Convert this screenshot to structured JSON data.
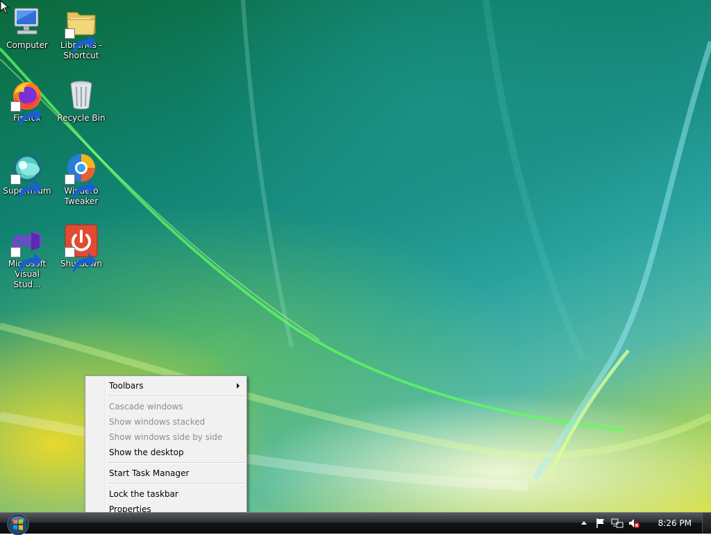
{
  "desktop": {
    "icons": [
      {
        "label": "Computer",
        "icon": "computer-icon"
      },
      {
        "label": "Libraries - Shortcut",
        "icon": "folder-icon"
      },
      {
        "label": "Firefox",
        "icon": "firefox-icon"
      },
      {
        "label": "Recycle Bin",
        "icon": "recycle-bin-icon"
      },
      {
        "label": "Supermium",
        "icon": "supermium-icon"
      },
      {
        "label": "Winaero Tweaker",
        "icon": "winaero-icon"
      },
      {
        "label": "Microsoft Visual Stud...",
        "icon": "visual-studio-icon"
      },
      {
        "label": "Shutdown",
        "icon": "shutdown-icon"
      }
    ]
  },
  "context_menu": {
    "toolbars": "Toolbars",
    "cascade": "Cascade windows",
    "stacked": "Show windows stacked",
    "side_by_side": "Show windows side by side",
    "show_desktop": "Show the desktop",
    "task_manager": "Start Task Manager",
    "lock": "Lock the taskbar",
    "properties": "Properties"
  },
  "taskbar": {
    "clock": "8:26 PM",
    "tray_icons": [
      "show-hidden-icons",
      "action-center-flag-icon",
      "network-icon",
      "volume-muted-icon"
    ]
  },
  "colors": {
    "accent": "#1a8f86",
    "menu_bg": "#f1f1f1",
    "disabled_text": "#8d8d8d"
  }
}
